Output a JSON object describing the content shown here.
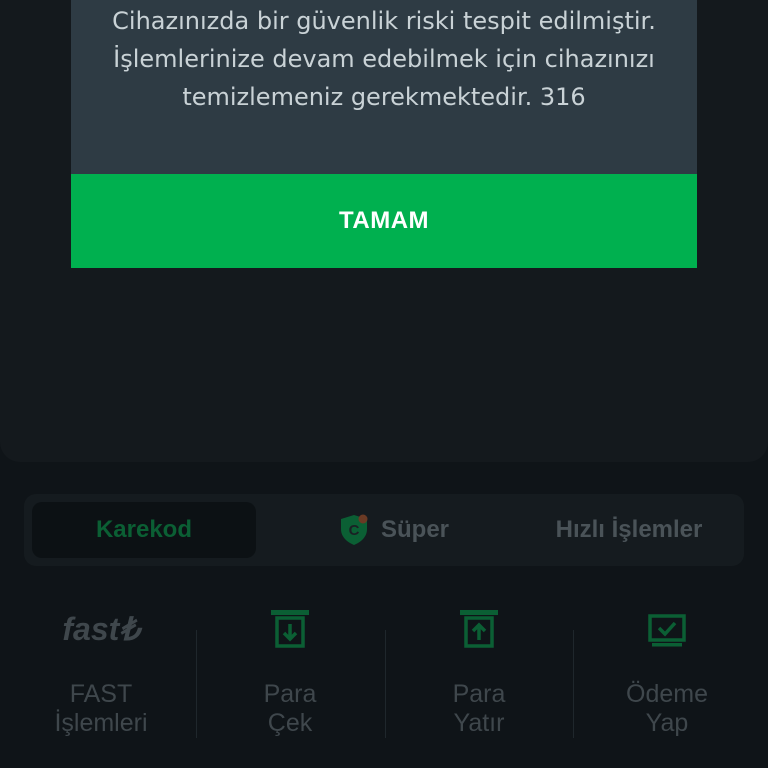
{
  "modal": {
    "message_lines": [
      "Cihazınızda bir güvenlik riski tespit edilmiştir.",
      "İşlemlerinize devam edebilmek için cihazınızı",
      "temizlemeniz gerekmektedir. 316"
    ],
    "ok_label": "TAMAM"
  },
  "tabs": [
    {
      "label": "Karekod",
      "active": true
    },
    {
      "label": "Süper",
      "active": false,
      "icon": "shield-c-icon"
    },
    {
      "label": "Hızlı İşlemler",
      "active": false
    }
  ],
  "actions": [
    {
      "logo": "fast₺",
      "line1": "FAST",
      "line2": "İşlemleri",
      "icon": "fast-logo"
    },
    {
      "line1": "Para",
      "line2": "Çek",
      "icon": "withdraw-icon"
    },
    {
      "line1": "Para",
      "line2": "Yatır",
      "icon": "deposit-icon"
    },
    {
      "line1": "Ödeme",
      "line2": "Yap",
      "icon": "payment-check-icon"
    }
  ],
  "colors": {
    "accent_green": "#00b04f",
    "dim_green": "#0b5f34",
    "modal_bg": "#2e3b44",
    "page_bg": "#0f1418"
  }
}
